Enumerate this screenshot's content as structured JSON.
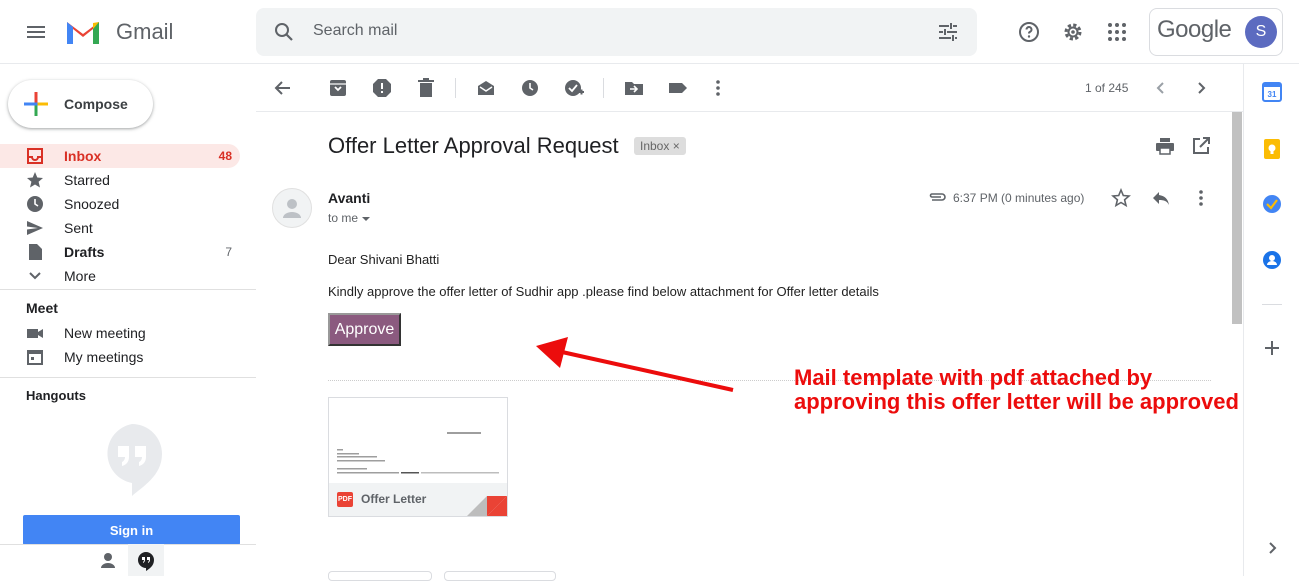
{
  "app": {
    "name": "Gmail"
  },
  "search": {
    "placeholder": "Search mail"
  },
  "account": {
    "google_label": "Google",
    "avatar_initial": "S"
  },
  "compose": {
    "label": "Compose"
  },
  "nav": [
    {
      "label": "Inbox",
      "count": "48",
      "icon": "inbox-icon"
    },
    {
      "label": "Starred",
      "count": "",
      "icon": "star-icon"
    },
    {
      "label": "Snoozed",
      "count": "",
      "icon": "clock-icon"
    },
    {
      "label": "Sent",
      "count": "",
      "icon": "send-icon"
    },
    {
      "label": "Drafts",
      "count": "7",
      "icon": "draft-icon"
    },
    {
      "label": "More",
      "count": "",
      "icon": "chevron-down-icon"
    }
  ],
  "meet": {
    "title": "Meet",
    "new_meeting": "New meeting",
    "my_meetings": "My meetings"
  },
  "hangouts": {
    "title": "Hangouts",
    "signin": "Sign in"
  },
  "toolbar": {
    "page_count": "1 of 245"
  },
  "message": {
    "subject": "Offer Letter Approval Request",
    "label_chip": "Inbox",
    "label_chip_close": "×",
    "sender": "Avanti",
    "to": "to me",
    "time": "6:37 PM (0 minutes ago)",
    "greeting": "Dear Shivani Bhatti",
    "body": "Kindly approve the offer letter of Sudhir app .please find below attachment for Offer letter details",
    "approve_button": "Approve",
    "attachment": {
      "name": "Offer Letter",
      "type_badge": "PDF"
    }
  },
  "annotation": {
    "line1": "Mail template with pdf attached by",
    "line2": "approving this offer letter will be approved",
    "color": "#ec0c0c"
  },
  "colors": {
    "inbox_accent": "#d93025",
    "approve_bg": "#8b5a7f",
    "signin_bg": "#4285f4"
  }
}
